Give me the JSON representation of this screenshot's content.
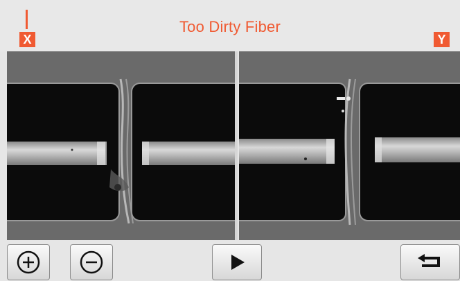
{
  "header": {
    "title": "Too Dirty Fiber",
    "x_label": "X",
    "y_label": "Y",
    "accent_color": "#f05a32"
  },
  "views": [
    {
      "axis": "X",
      "description_icon": "fiber-splice-view"
    },
    {
      "axis": "Y",
      "description_icon": "fiber-splice-view"
    }
  ],
  "toolbar": {
    "zoom_in_icon": "zoom-in-icon",
    "zoom_out_icon": "zoom-out-icon",
    "play_icon": "play-icon",
    "back_icon": "return-icon"
  }
}
